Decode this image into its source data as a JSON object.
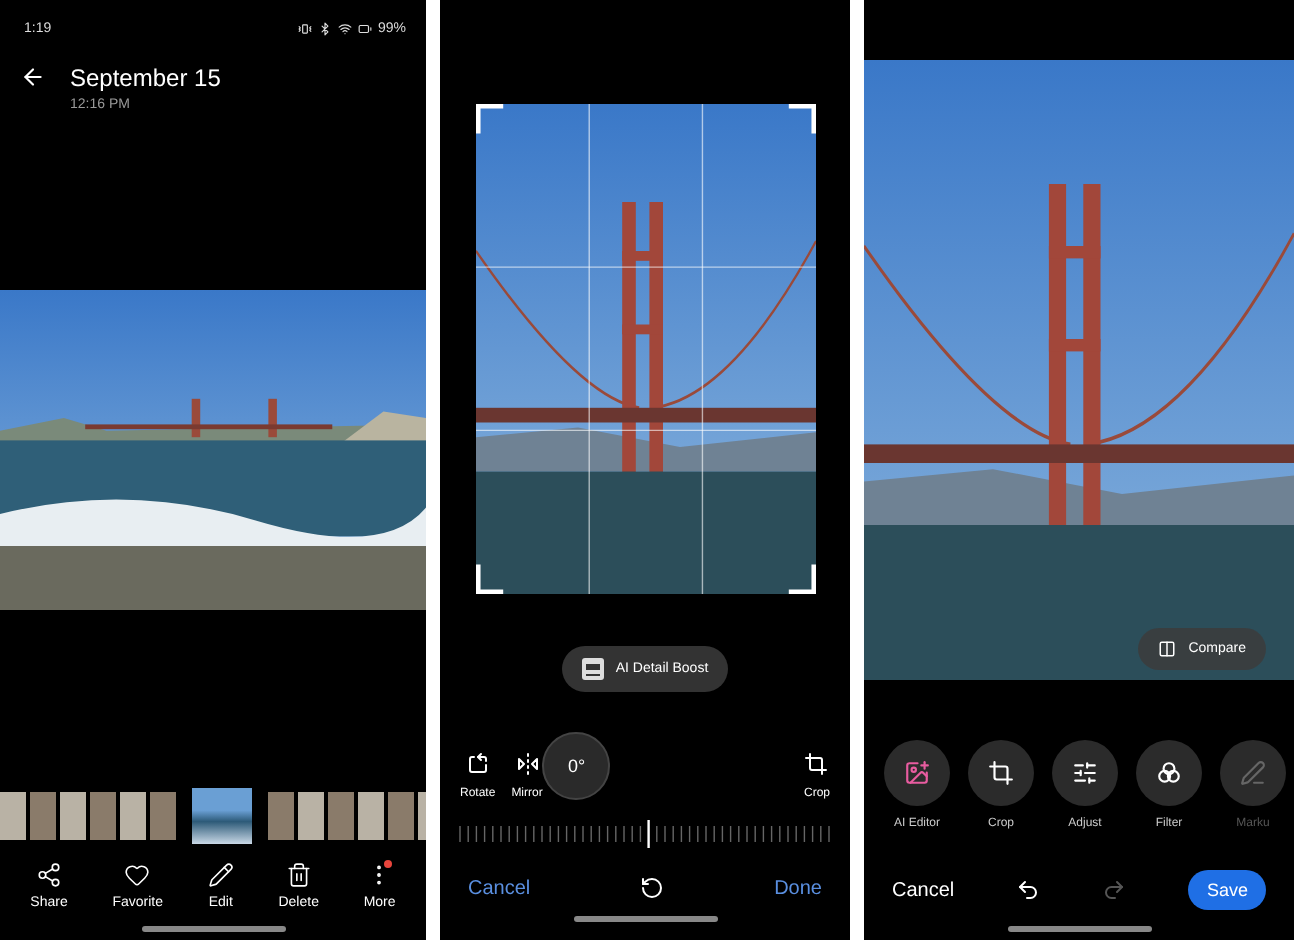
{
  "viewer": {
    "status_bar": {
      "time": "1:19",
      "battery": "99%"
    },
    "title": "September 15",
    "subtitle": "12:16 PM",
    "filmstrip": [
      {
        "selected": false
      },
      {
        "selected": false
      },
      {
        "selected": false
      },
      {
        "selected": false
      },
      {
        "selected": false
      },
      {
        "selected": false
      },
      {
        "selected": true
      },
      {
        "selected": false
      },
      {
        "selected": false
      },
      {
        "selected": false
      },
      {
        "selected": false
      },
      {
        "selected": false
      },
      {
        "selected": false
      }
    ],
    "actions": [
      {
        "label": "Share",
        "badge": false
      },
      {
        "label": "Favorite",
        "badge": false
      },
      {
        "label": "Edit",
        "badge": false
      },
      {
        "label": "Delete",
        "badge": false
      },
      {
        "label": "More",
        "badge": true
      }
    ]
  },
  "rotate_editor": {
    "boost_label": "AI Detail Boost",
    "angle": "0°",
    "tools": [
      {
        "label": "Rotate"
      },
      {
        "label": "Mirror"
      },
      {
        "label": "Crop"
      }
    ],
    "cancel": "Cancel",
    "done": "Done"
  },
  "editor": {
    "compare": "Compare",
    "tools": [
      {
        "label": "AI Editor"
      },
      {
        "label": "Crop"
      },
      {
        "label": "Adjust"
      },
      {
        "label": "Filter"
      },
      {
        "label": "Marku"
      }
    ],
    "cancel": "Cancel",
    "undo": {
      "disabled": false
    },
    "redo": {
      "disabled": true
    },
    "save": "Save"
  }
}
